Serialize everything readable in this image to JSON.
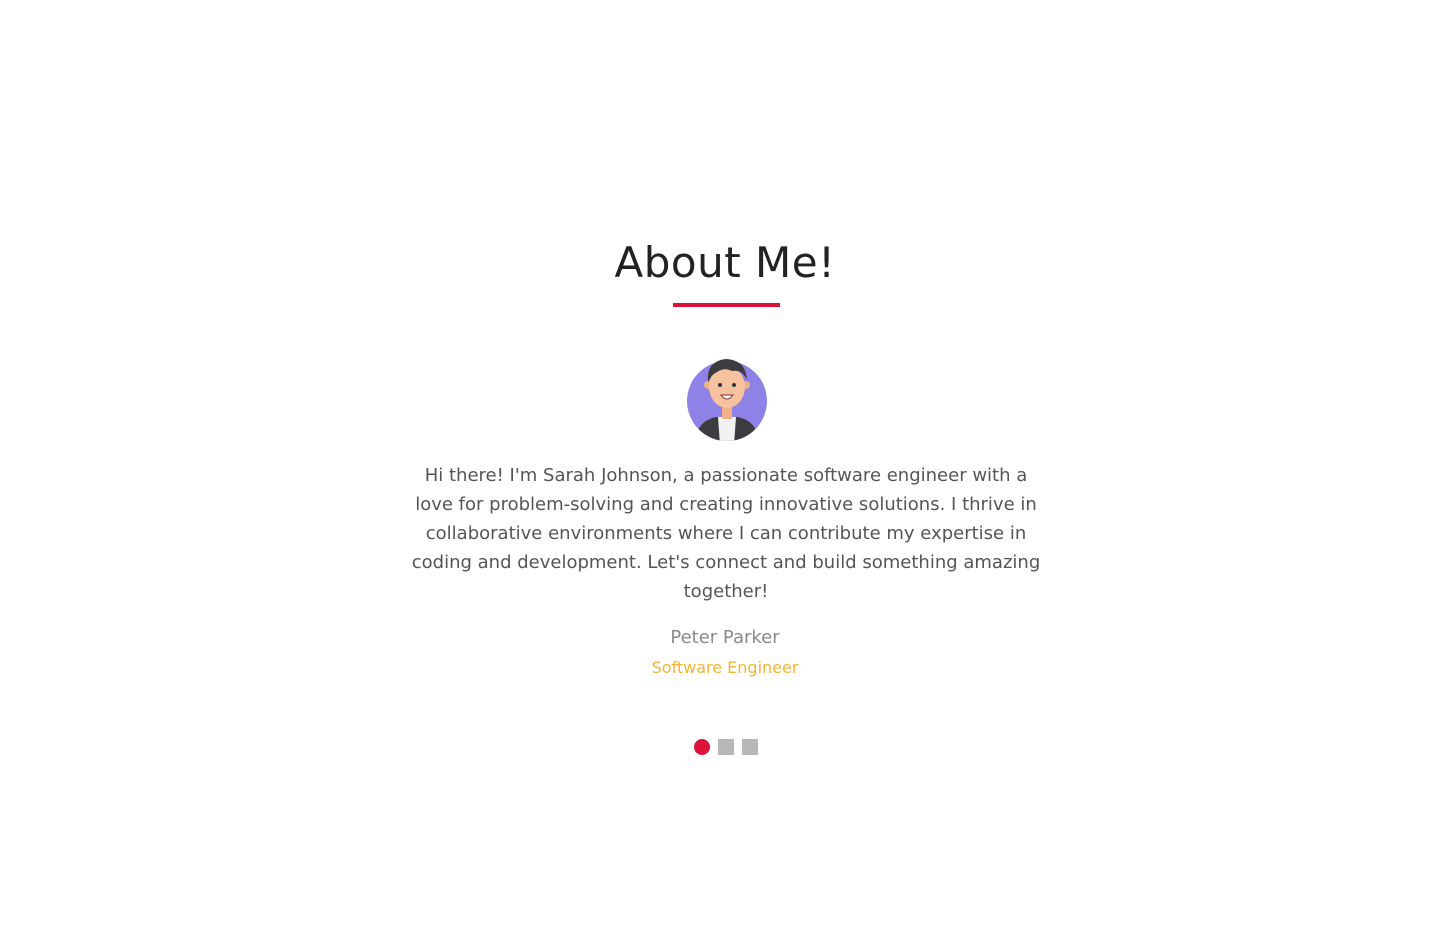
{
  "about": {
    "title": "About Me!",
    "bio": "Hi there! I'm Sarah Johnson, a passionate software engineer with a love for problem-solving and creating innovative solutions. I thrive in collaborative environments where I can contribute my expertise in coding and development. Let's connect and build something amazing together!",
    "name": "Peter Parker",
    "role": "Software Engineer",
    "avatar_icon": "person-avatar-icon"
  },
  "carousel": {
    "active_index": 0,
    "dot_count": 3
  },
  "colors": {
    "accent": "#dc143c",
    "role": "#f5b335",
    "avatar_bg": "#8f82e6",
    "dot_inactive": "#b8b8b8"
  }
}
